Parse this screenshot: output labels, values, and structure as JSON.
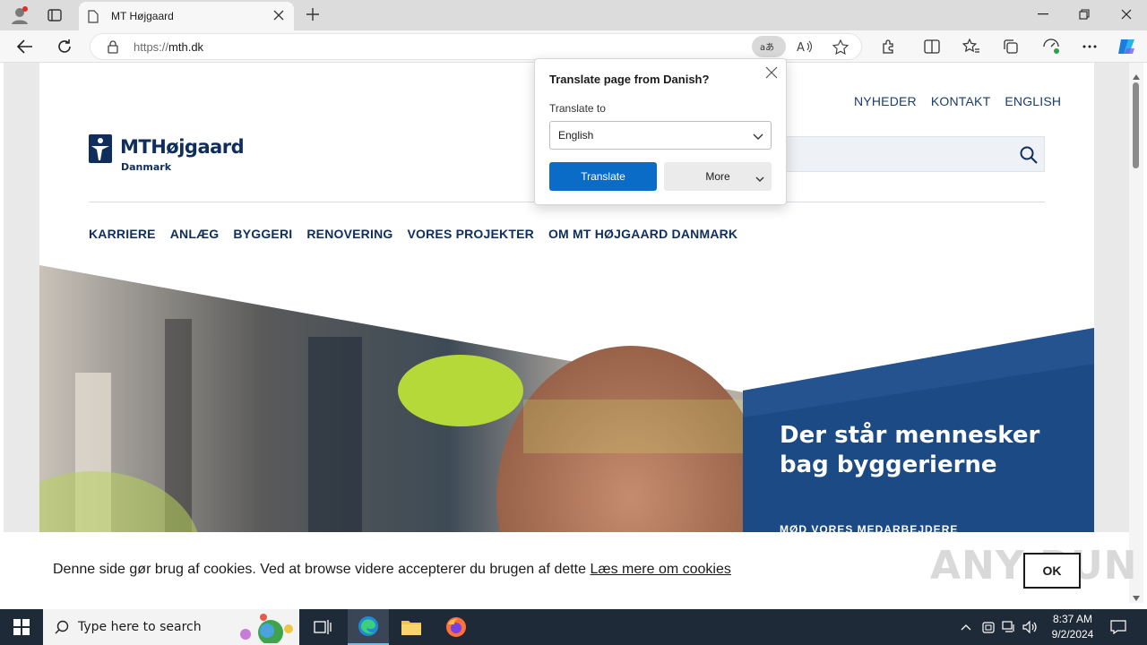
{
  "browser": {
    "tab_title": "MT Højgaard",
    "url_protocol": "https://",
    "url_host": "mth.dk"
  },
  "site": {
    "logo_name": "MTHøjgaard",
    "logo_sub": "Danmark",
    "utility_links": [
      "NYHEDER",
      "KONTAKT",
      "ENGLISH"
    ],
    "nav": [
      "KARRIERE",
      "ANLÆG",
      "BYGGERI",
      "RENOVERING",
      "VORES PROJEKTER",
      "OM MT HØJGAARD DANMARK"
    ],
    "hero_title_line1": "Der står mennesker",
    "hero_title_line2": "bag byggerierne",
    "hero_sub": "MØD VORES MEDARBEJDERE",
    "brand_color": "#0f2e5c",
    "hero_panel_color": "#1c4a84"
  },
  "translate_popup": {
    "title": "Translate page from Danish?",
    "label": "Translate to",
    "selected_language": "English",
    "translate_button": "Translate",
    "more_button": "More"
  },
  "cookie_banner": {
    "message": "Denne side gør brug af cookies. Ved at browse videre accepterer du brugen af dette",
    "link": "Læs mere om cookies",
    "ok": "OK"
  },
  "watermark": "ANY RUN",
  "taskbar": {
    "search_placeholder": "Type here to search",
    "time": "8:37 AM",
    "date": "9/2/2024"
  }
}
